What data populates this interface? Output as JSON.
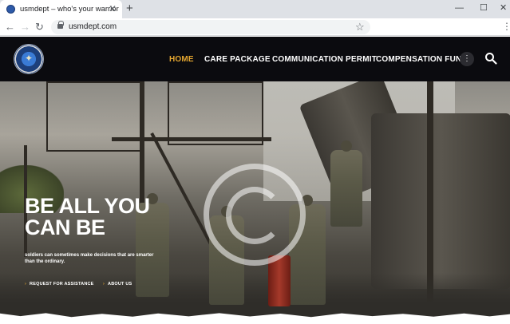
{
  "browser": {
    "tab_title": "usmdept – who's your warrior",
    "tab_close_icon": "close-icon",
    "new_tab_symbol": "+",
    "url": "usmdept.com",
    "window_controls": [
      "—",
      "☐",
      "✕"
    ]
  },
  "site": {
    "nav": {
      "items": [
        {
          "label": "HOME",
          "active": true
        },
        {
          "label": "CARE PACKAGE",
          "active": false
        },
        {
          "label": "COMMUNICATION PERMIT",
          "active": false
        },
        {
          "label": "COMPENSATION FUND",
          "active": false
        }
      ],
      "more_symbol": "⋮",
      "accent_color": "#e4a630"
    },
    "hero": {
      "title": "BE ALL YOU CAN BE",
      "subtitle": "soldiers can sometimes make decisions that are smarter than the ordinary.",
      "cta_primary": "REQUEST FOR ASSISTANCE",
      "cta_secondary": "ABOUT US"
    }
  }
}
